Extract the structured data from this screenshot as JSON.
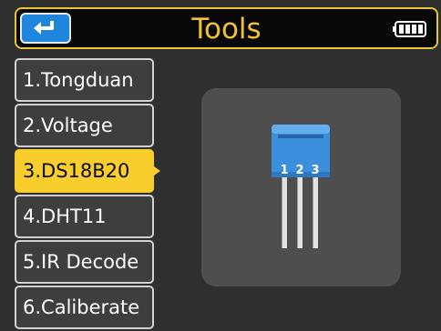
{
  "header": {
    "title": "Tools",
    "back_icon": "return-arrow-icon",
    "battery_icon": "battery-full-icon"
  },
  "menu": {
    "items": [
      {
        "label": "1.Tongduan"
      },
      {
        "label": "2.Voltage"
      },
      {
        "label": "3.DS18B20"
      },
      {
        "label": "4.DHT11"
      },
      {
        "label": "5.IR Decode"
      },
      {
        "label": "6.Caliberate"
      }
    ],
    "selected_index": 2
  },
  "preview": {
    "icon": "ds18b20-sensor-icon",
    "pins": [
      "1",
      "2",
      "3"
    ]
  },
  "colors": {
    "accent": "#f8ce2c",
    "title": "#f2c230",
    "back_button": "#1f86de",
    "sensor_body": "#3c8fdc"
  }
}
